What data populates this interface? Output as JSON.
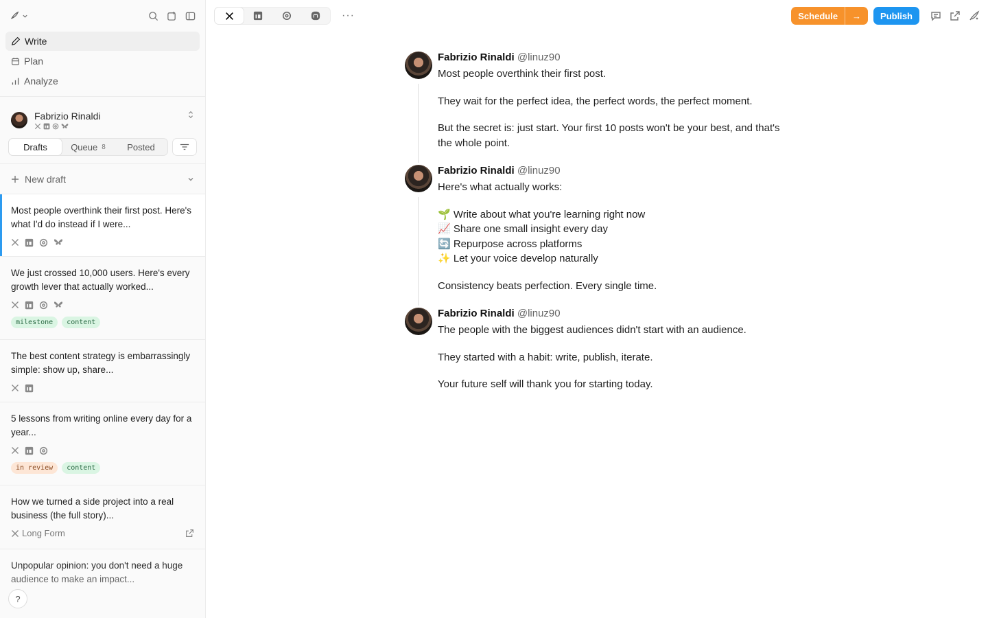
{
  "sidebar": {
    "nav": [
      {
        "label": "Write",
        "icon": "pen-icon",
        "active": true
      },
      {
        "label": "Plan",
        "icon": "calendar-icon",
        "active": false
      },
      {
        "label": "Analyze",
        "icon": "bar-chart-icon",
        "active": false
      }
    ],
    "account": {
      "name": "Fabrizio Rinaldi"
    },
    "tabs": [
      {
        "label": "Drafts",
        "count": ""
      },
      {
        "label": "Queue",
        "count": "8"
      },
      {
        "label": "Posted",
        "count": ""
      }
    ],
    "new_draft_label": "New draft",
    "drafts": [
      {
        "text": "Most people overthink their first post. Here's what I'd do instead if I were...",
        "icons": [
          "x",
          "linkedin",
          "threads",
          "bluesky"
        ],
        "tags": []
      },
      {
        "text": "We just crossed 10,000 users. Here's every growth lever that actually worked...",
        "icons": [
          "x",
          "linkedin",
          "threads",
          "bluesky"
        ],
        "tags": [
          {
            "label": "milestone",
            "color": "green"
          },
          {
            "label": "content",
            "color": "green"
          }
        ]
      },
      {
        "text": "The best content strategy is embarrassingly simple: show up, share...",
        "icons": [
          "x",
          "linkedin"
        ],
        "tags": []
      },
      {
        "text": "5 lessons from writing online every day for a year...",
        "icons": [
          "x",
          "linkedin",
          "threads"
        ],
        "tags": [
          {
            "label": "in review",
            "color": "orange"
          },
          {
            "label": "content",
            "color": "green"
          }
        ]
      },
      {
        "text": "How we turned a side project into a real business (the full story)...",
        "longform": "Long Form"
      },
      {
        "text": "Unpopular opinion: you don't need a huge audience to make an impact..."
      }
    ],
    "help_label": "?"
  },
  "topbar": {
    "more_label": "···",
    "schedule_label": "Schedule",
    "schedule_arrow": "→",
    "publish_label": "Publish"
  },
  "thread": [
    {
      "name": "Fabrizio Rinaldi",
      "handle": "@linuz90",
      "paragraphs": [
        "Most people overthink their first post.",
        "They wait for the perfect idea, the perfect words, the perfect moment.",
        "But the secret is: just start. Your first 10 posts won't be your best, and that's the whole point."
      ]
    },
    {
      "name": "Fabrizio Rinaldi",
      "handle": "@linuz90",
      "paragraphs": [
        "Here's what actually works:",
        "🌱 Write about what you're learning right now\n📈 Share one small insight every day\n🔄 Repurpose across platforms\n✨ Let your voice develop naturally",
        "Consistency beats perfection. Every single time."
      ]
    },
    {
      "name": "Fabrizio Rinaldi",
      "handle": "@linuz90",
      "paragraphs": [
        "The people with the biggest audiences didn't start with an audience.",
        "They started with a habit: write, publish, iterate.",
        "Your future self will thank you for starting today."
      ]
    }
  ],
  "colors": {
    "accent": "#2d9bf0",
    "schedule": "#f7922b",
    "publish": "#1d95f0"
  }
}
